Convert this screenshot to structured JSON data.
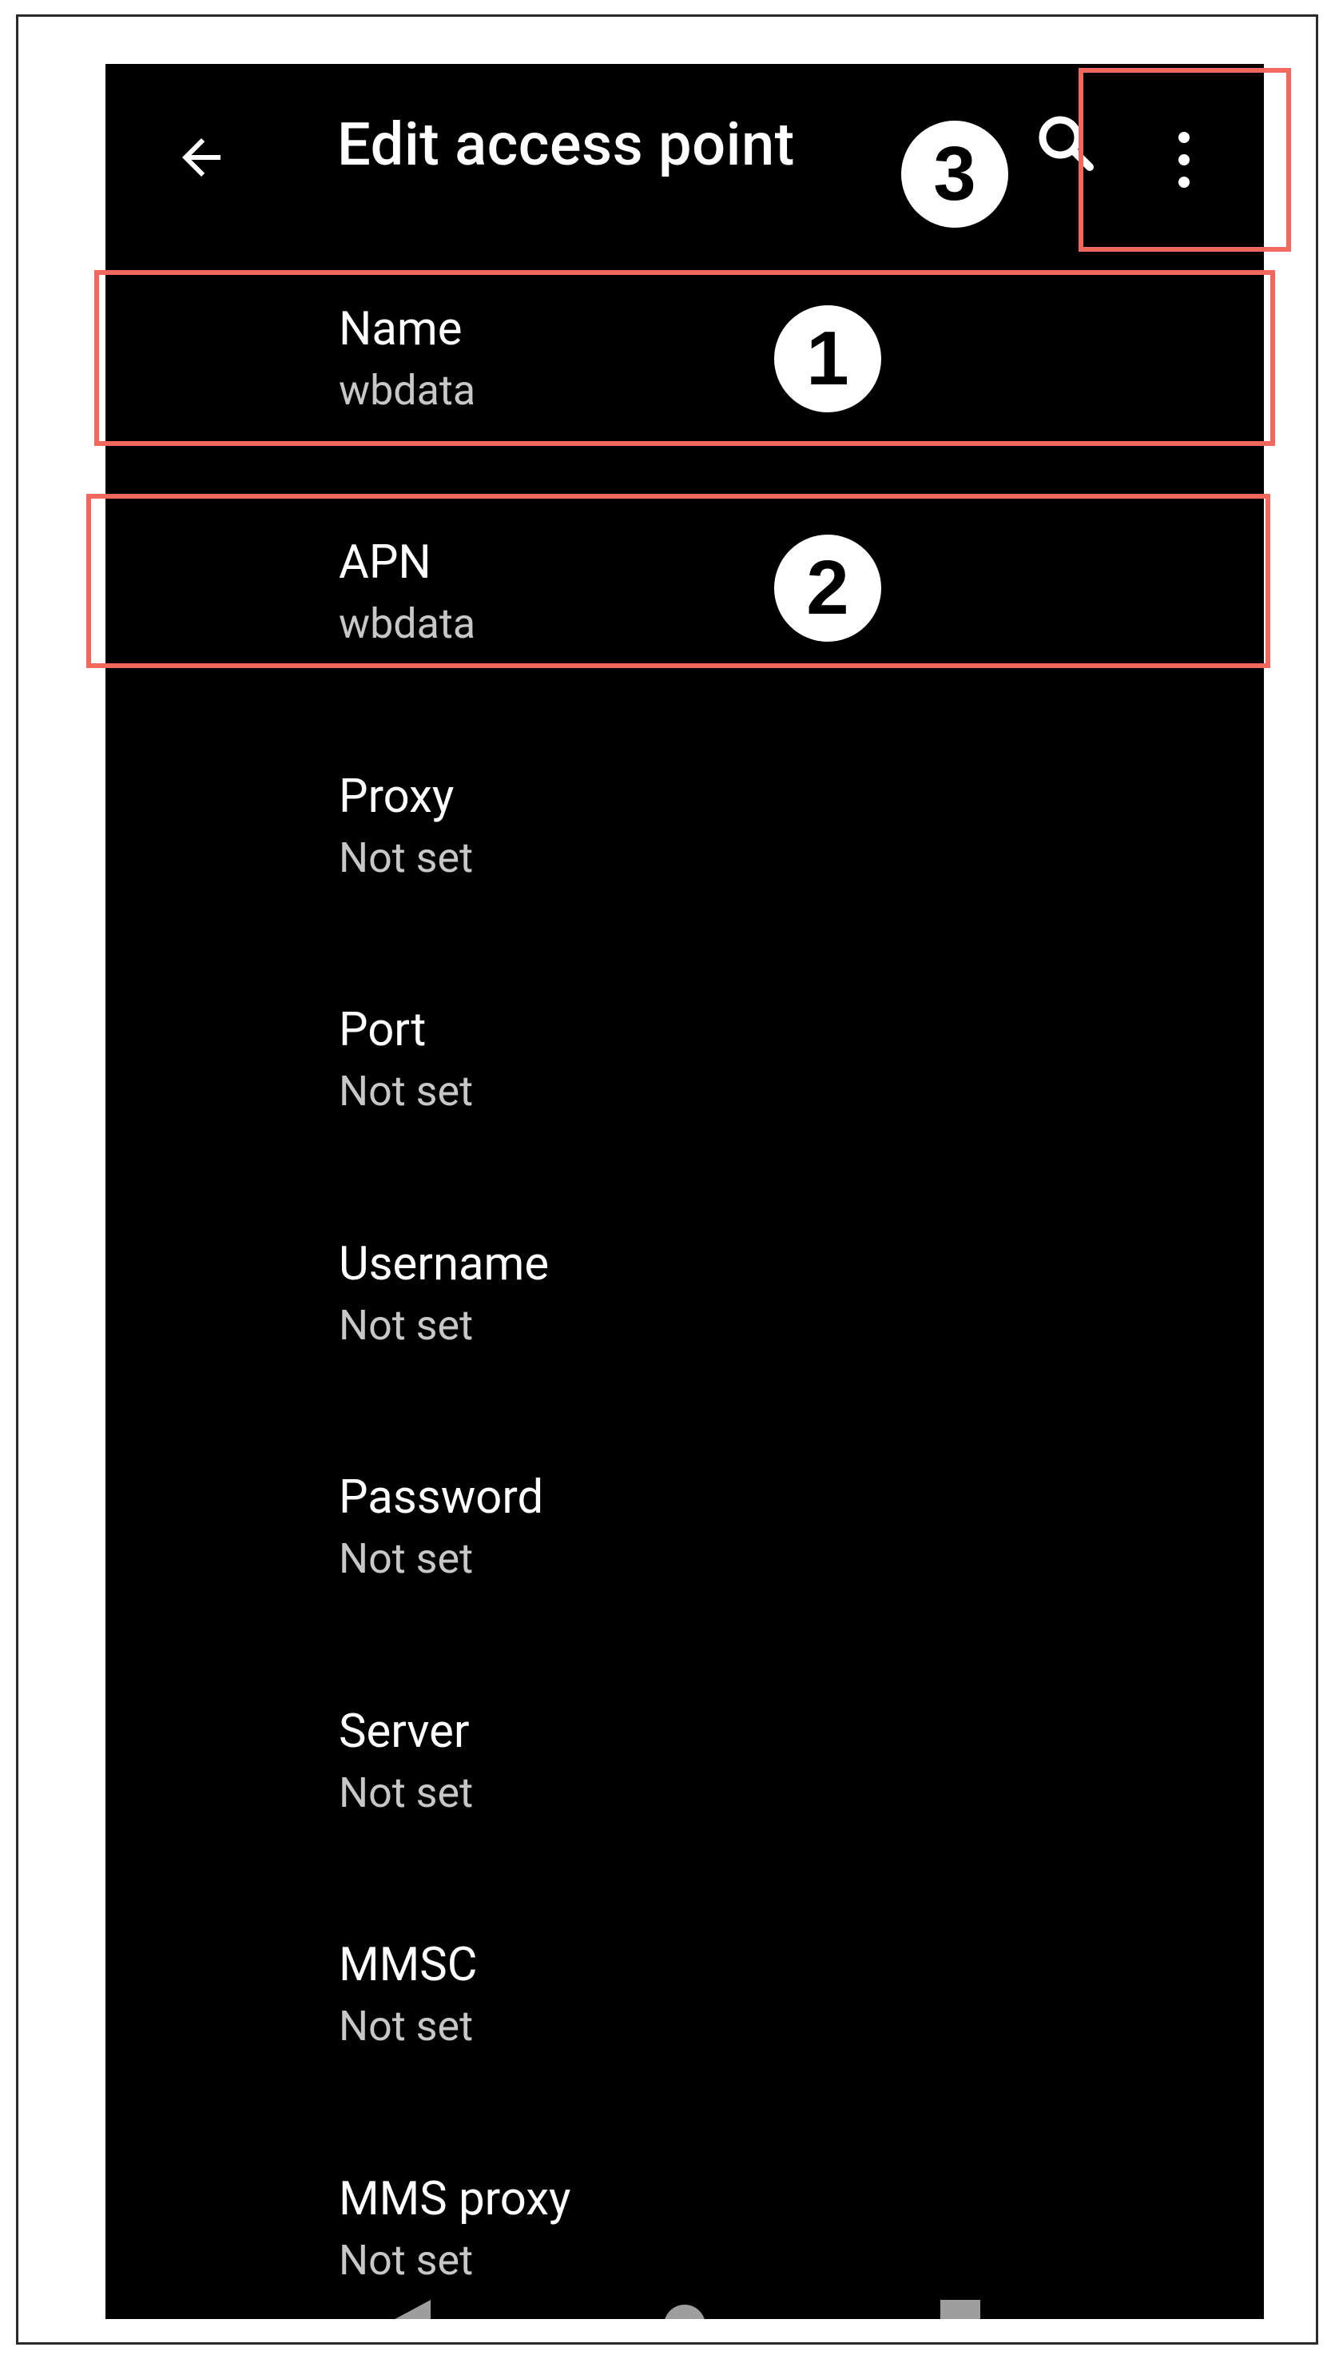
{
  "toolbar": {
    "title": "Edit access point",
    "back_icon": "arrow-back-icon",
    "search_icon": "search-icon",
    "more_icon": "more-vert-icon"
  },
  "preferences": [
    {
      "title": "Name",
      "summary": "wbdata"
    },
    {
      "title": "APN",
      "summary": "wbdata"
    },
    {
      "title": "Proxy",
      "summary": "Not set"
    },
    {
      "title": "Port",
      "summary": "Not set"
    },
    {
      "title": "Username",
      "summary": "Not set"
    },
    {
      "title": "Password",
      "summary": "Not set"
    },
    {
      "title": "Server",
      "summary": "Not set"
    },
    {
      "title": "MMSC",
      "summary": "Not set"
    },
    {
      "title": "MMS proxy",
      "summary": "Not set"
    }
  ],
  "annotations": {
    "badges": [
      "1",
      "2",
      "3"
    ],
    "highlight_color": "#f0695c"
  },
  "colors": {
    "screen_background": "#000000",
    "primary_text": "#ffffff",
    "secondary_text": "#c7c7c7"
  }
}
